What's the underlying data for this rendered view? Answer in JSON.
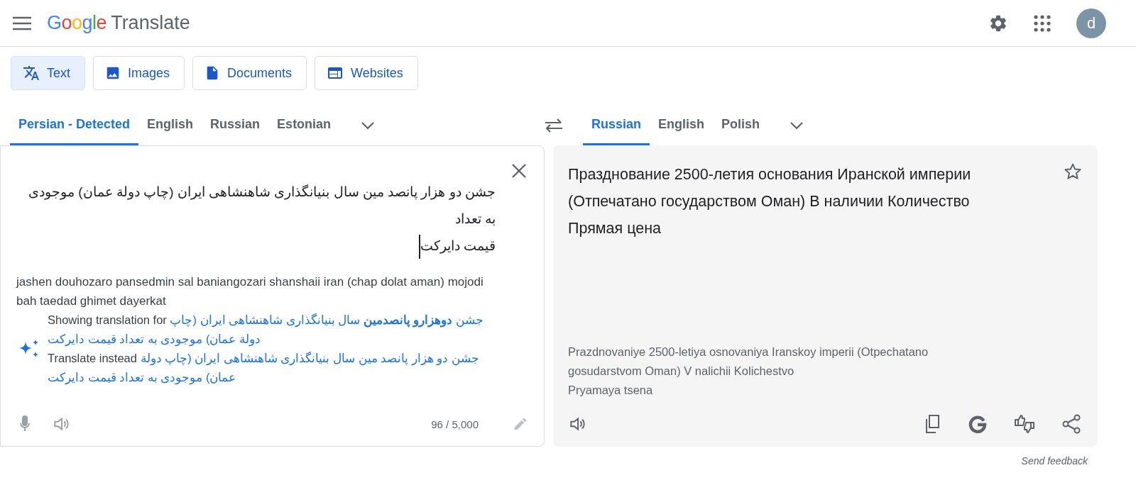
{
  "header": {
    "logo_brand": "Google",
    "logo_product": "Translate",
    "avatar_letter": "d"
  },
  "modes": [
    {
      "label": "Text",
      "kind": "translate",
      "selected": true
    },
    {
      "label": "Images",
      "kind": "image",
      "selected": false
    },
    {
      "label": "Documents",
      "kind": "document",
      "selected": false
    },
    {
      "label": "Websites",
      "kind": "web",
      "selected": false
    }
  ],
  "source_languages": [
    {
      "label": "Persian - Detected",
      "selected": true
    },
    {
      "label": "English",
      "selected": false
    },
    {
      "label": "Russian",
      "selected": false
    },
    {
      "label": "Estonian",
      "selected": false
    }
  ],
  "target_languages": [
    {
      "label": "Russian",
      "selected": true
    },
    {
      "label": "English",
      "selected": false
    },
    {
      "label": "Polish",
      "selected": false
    }
  ],
  "source": {
    "lines": [
      "جشن دو هزار پانصد مین سال بنیانگذاری شاهنشاهی ایران (چاپ دولة عمان) موجودی به تعداد",
      "قیمت دایرکت"
    ],
    "transliteration": "jashen douhozaro pansedmin sal baniangozari shanshaii iran (chap dolat aman) mojodi bah taedad ghimet dayerkat",
    "suggestion_showing_label": "Showing translation for",
    "suggestion_showing_text": "جشن **دوهزارو پانصدمین** سال بنیانگذاری شاهنشاهی ایران (چاپ دولة عمان) موجودی به تعداد قیمت دایرکت",
    "suggestion_instead_label": "Translate instead",
    "suggestion_instead_text": "جشن دو هزار پانصد مین سال بنیانگذاری شاهنشاهی ایران (چاپ دولة عمان) موجودی به تعداد قیمت دایرکت",
    "char_count": "96 / 5,000"
  },
  "target": {
    "lines": [
      "Празднование 2500-летия основания Иранской империи (Отпечатано государством Оман) В наличии Количество",
      "Прямая цена"
    ],
    "transliteration_lines": [
      "Prazdnovaniye 2500-letiya osnovaniya Iranskoy imperii (Otpechatano gosudarstvom Oman) V nalichii Kolichestvo",
      "Pryamaya tsena"
    ],
    "saved": false
  },
  "feedback": "Send feedback"
}
